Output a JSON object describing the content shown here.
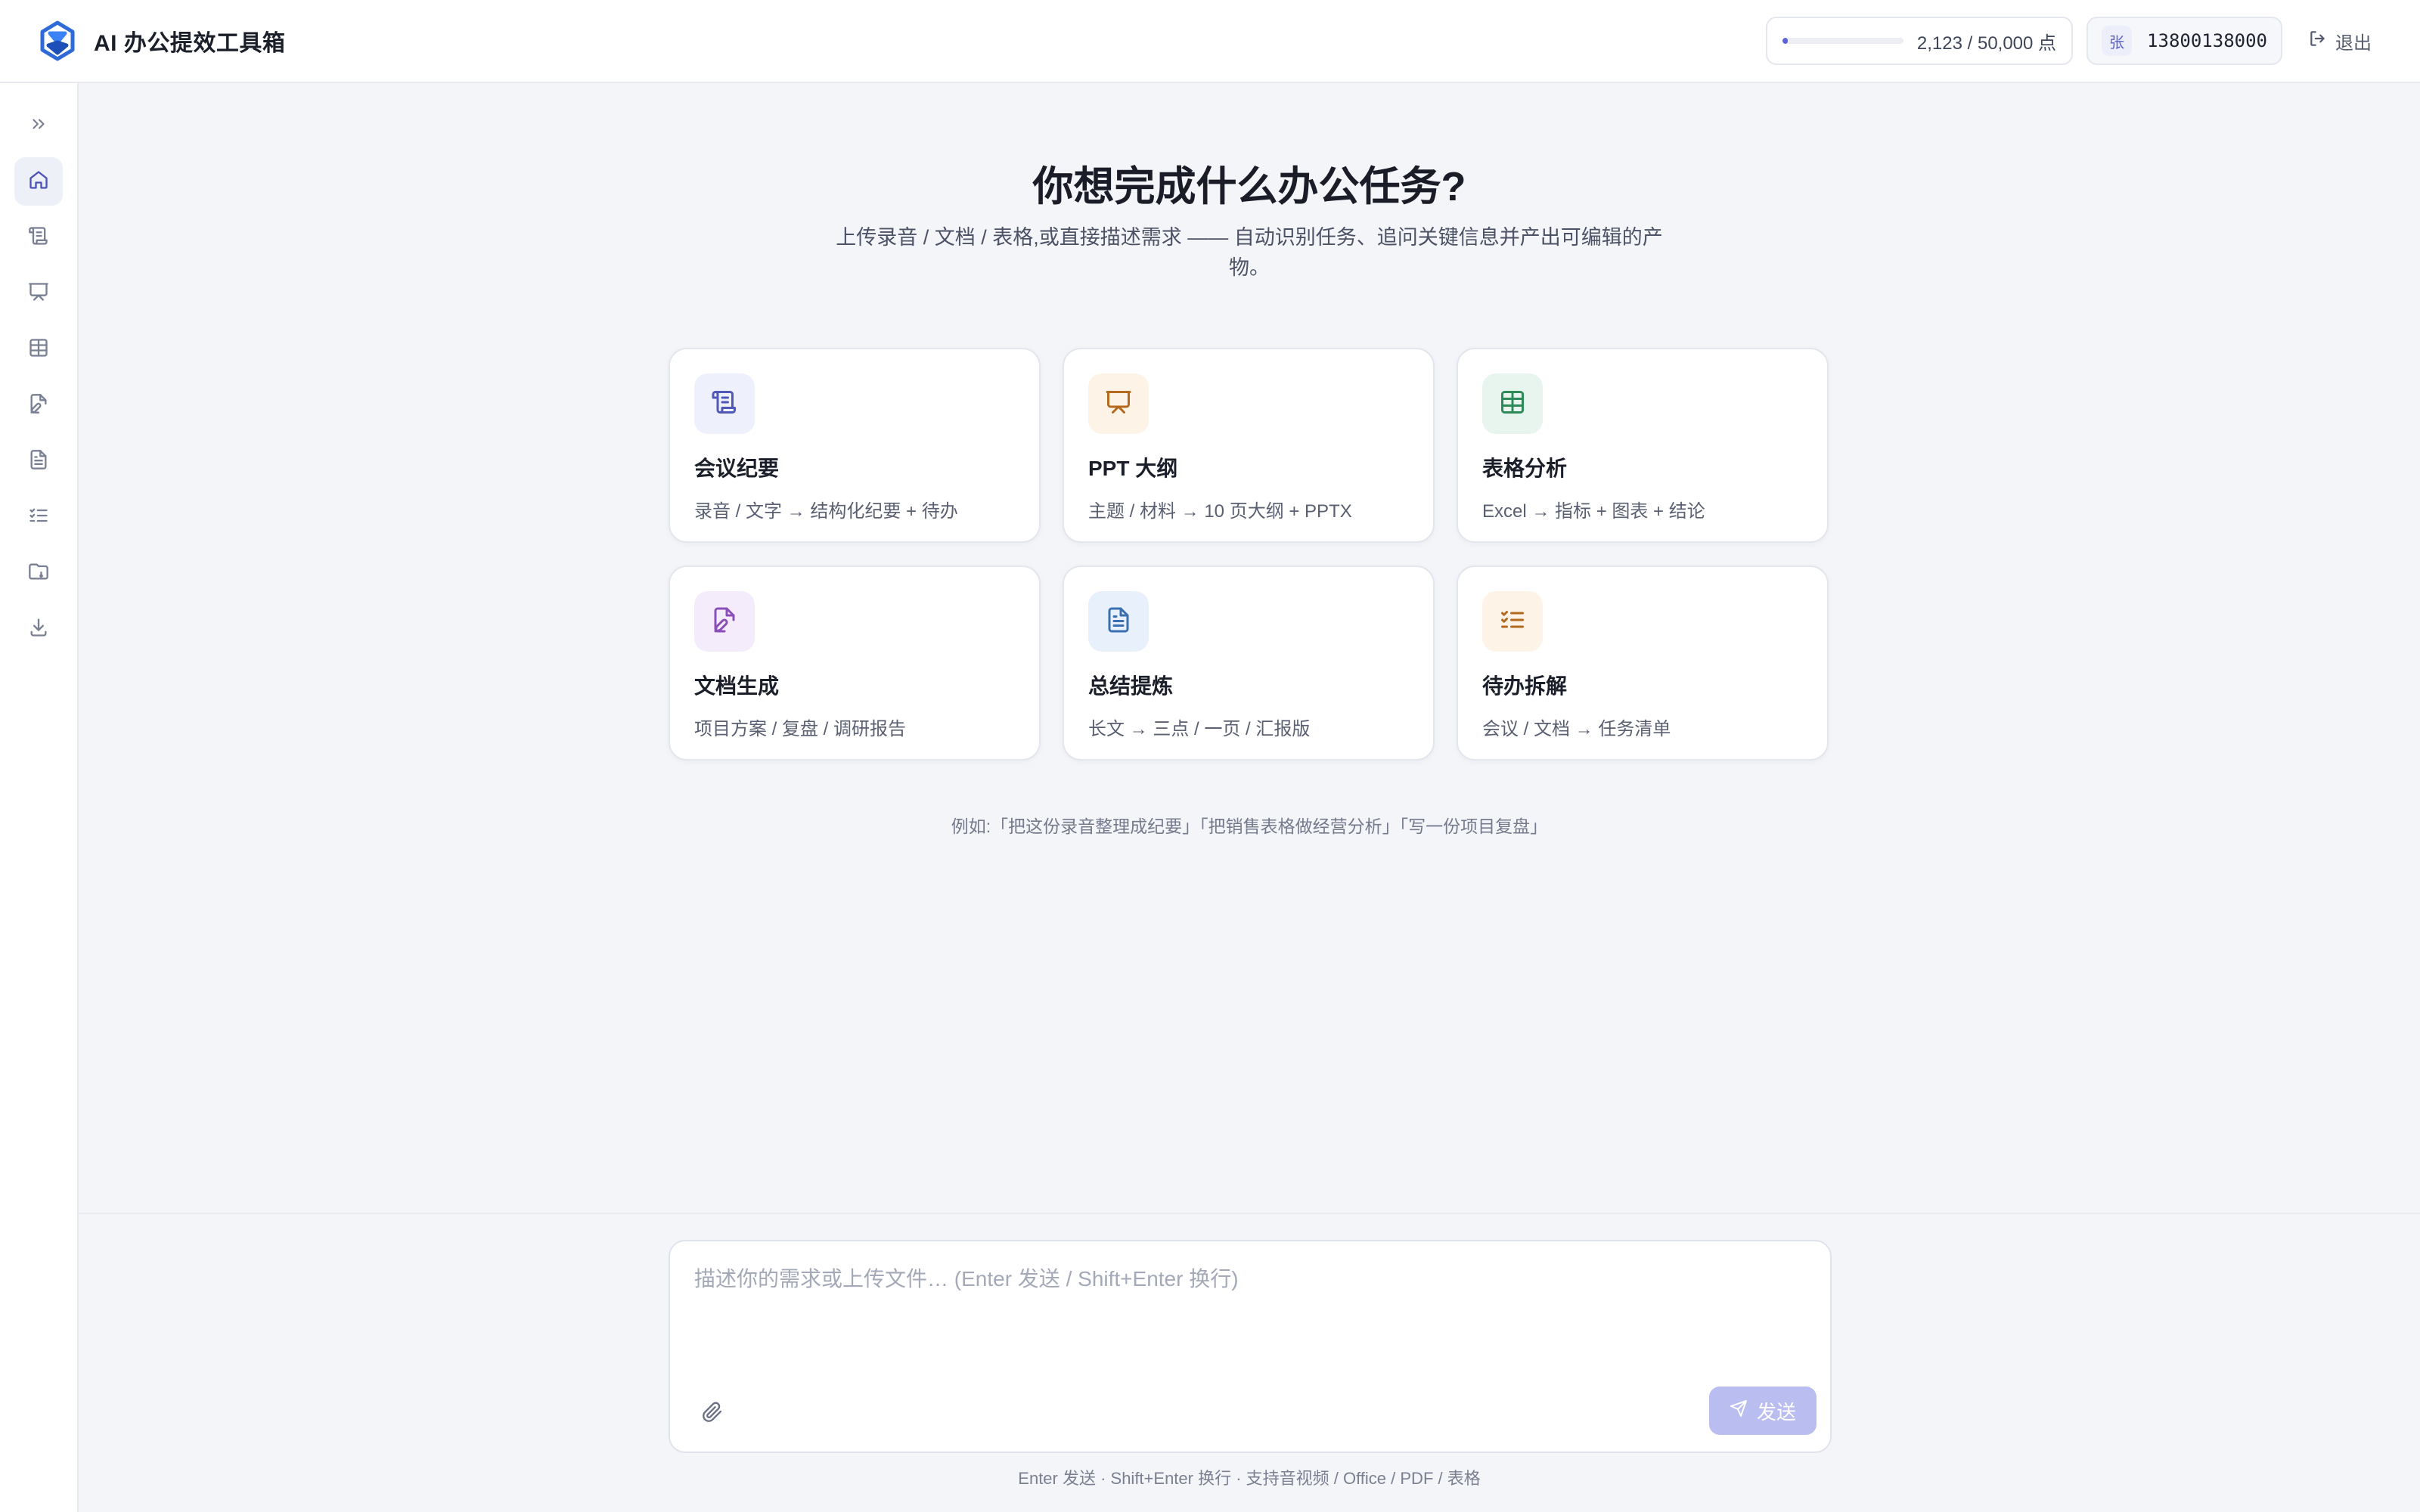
{
  "app": {
    "title": "AI 办公提效工具箱",
    "accent": "#5b63d6"
  },
  "header": {
    "quota_fraction": 0.0425,
    "quota_text": "2,123 / 50,000 点",
    "account": {
      "avatar": "张",
      "phone": "13800138000"
    },
    "logout_label": "退出"
  },
  "sidebar": {
    "items": [
      {
        "icon": "chevrons-right-icon"
      },
      {
        "icon": "home-icon",
        "active": true
      },
      {
        "icon": "scroll-icon"
      },
      {
        "icon": "presentation-icon"
      },
      {
        "icon": "table-icon"
      },
      {
        "icon": "file-pen-icon"
      },
      {
        "icon": "file-text-icon"
      },
      {
        "icon": "list-checks-icon"
      },
      {
        "icon": "folder-icon"
      },
      {
        "icon": "download-icon"
      }
    ]
  },
  "hero": {
    "title": "你想完成什么办公任务?",
    "subtitle": "上传录音 / 文档 / 表格,或直接描述需求 —— 自动识别任务、追问关键信息并产出可编辑的产物。"
  },
  "cards": [
    {
      "title": "会议纪要",
      "desc": "录音 / 文字 → 结构化纪要 + 待办",
      "icon": "scroll-icon",
      "tint": "#eef0fb",
      "color": "#5058b8"
    },
    {
      "title": "PPT 大纲",
      "desc": "主题 / 材料 → 10 页大纲 + PPTX",
      "icon": "presentation-icon",
      "tint": "#fdf3e6",
      "color": "#b46a1e"
    },
    {
      "title": "表格分析",
      "desc": "Excel → 指标 + 图表 + 结论",
      "icon": "table-icon",
      "tint": "#e8f5ee",
      "color": "#2f8a5a"
    },
    {
      "title": "文档生成",
      "desc": "项目方案 / 复盘 / 调研报告",
      "icon": "file-pen-icon",
      "tint": "#f4ecfa",
      "color": "#8a4fb8"
    },
    {
      "title": "总结提炼",
      "desc": "长文 → 三点 / 一页 / 汇报版",
      "icon": "file-text-icon",
      "tint": "#e8f1fb",
      "color": "#3a6fb0"
    },
    {
      "title": "待办拆解",
      "desc": "会议 / 文档 → 任务清单",
      "icon": "list-checks-icon",
      "tint": "#fdf3e6",
      "color": "#b46a1e"
    }
  ],
  "example": "例如:「把这份录音整理成纪要」「把销售表格做经营分析」「写一份项目复盘」",
  "composer": {
    "placeholder": "描述你的需求或上传文件… (Enter 发送 / Shift+Enter 换行)",
    "send_label": "发送",
    "hint": "Enter 发送 · Shift+Enter 换行 · 支持音视频 / Office / PDF / 表格"
  }
}
